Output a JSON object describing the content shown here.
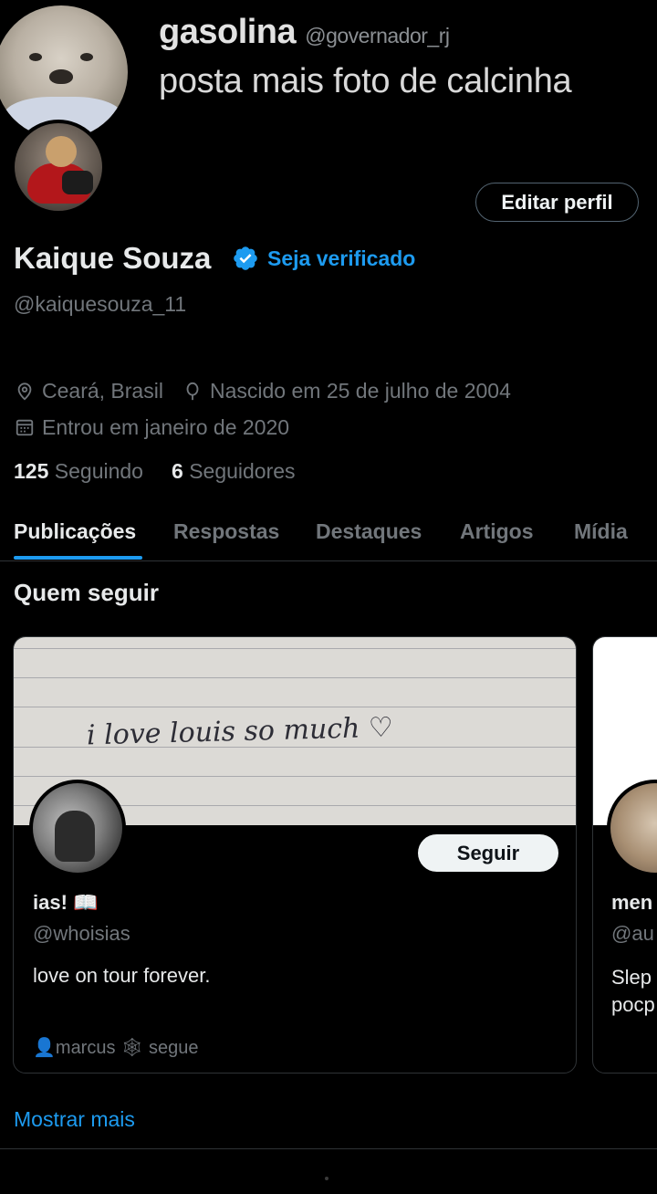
{
  "header": {
    "tweet_author_name": "gasolina",
    "tweet_author_handle": "@governador_rj",
    "tweet_text": "posta mais foto de calcinha"
  },
  "profile": {
    "edit_button": "Editar perfil",
    "name": "Kaique Souza",
    "verify_link": "Seja verificado",
    "handle": "@kaiquesouza_11",
    "location": "Ceará, Brasil",
    "birthday": "Nascido em 25 de julho de 2004",
    "joined": "Entrou em janeiro de 2020",
    "following_count": "125",
    "following_label": "Seguindo",
    "followers_count": "6",
    "followers_label": "Seguidores",
    "accent_color": "#1d9bf0"
  },
  "tabs": [
    {
      "label": "Publicações",
      "active": true
    },
    {
      "label": "Respostas",
      "active": false
    },
    {
      "label": "Destaques",
      "active": false
    },
    {
      "label": "Artigos",
      "active": false
    },
    {
      "label": "Mídia",
      "active": false
    }
  ],
  "who_to_follow": {
    "title": "Quem seguir",
    "cards": [
      {
        "banner_text": "i love louis so much ♡",
        "follow_button": "Seguir",
        "name": "ias! 📖",
        "handle": "@whoisias",
        "bio": "love on tour forever.",
        "social_context": "👤marcus 🕸 segue"
      },
      {
        "name": "men",
        "handle": "@au",
        "bio": "Slep\npocp"
      }
    ],
    "show_more": "Mostrar mais"
  }
}
